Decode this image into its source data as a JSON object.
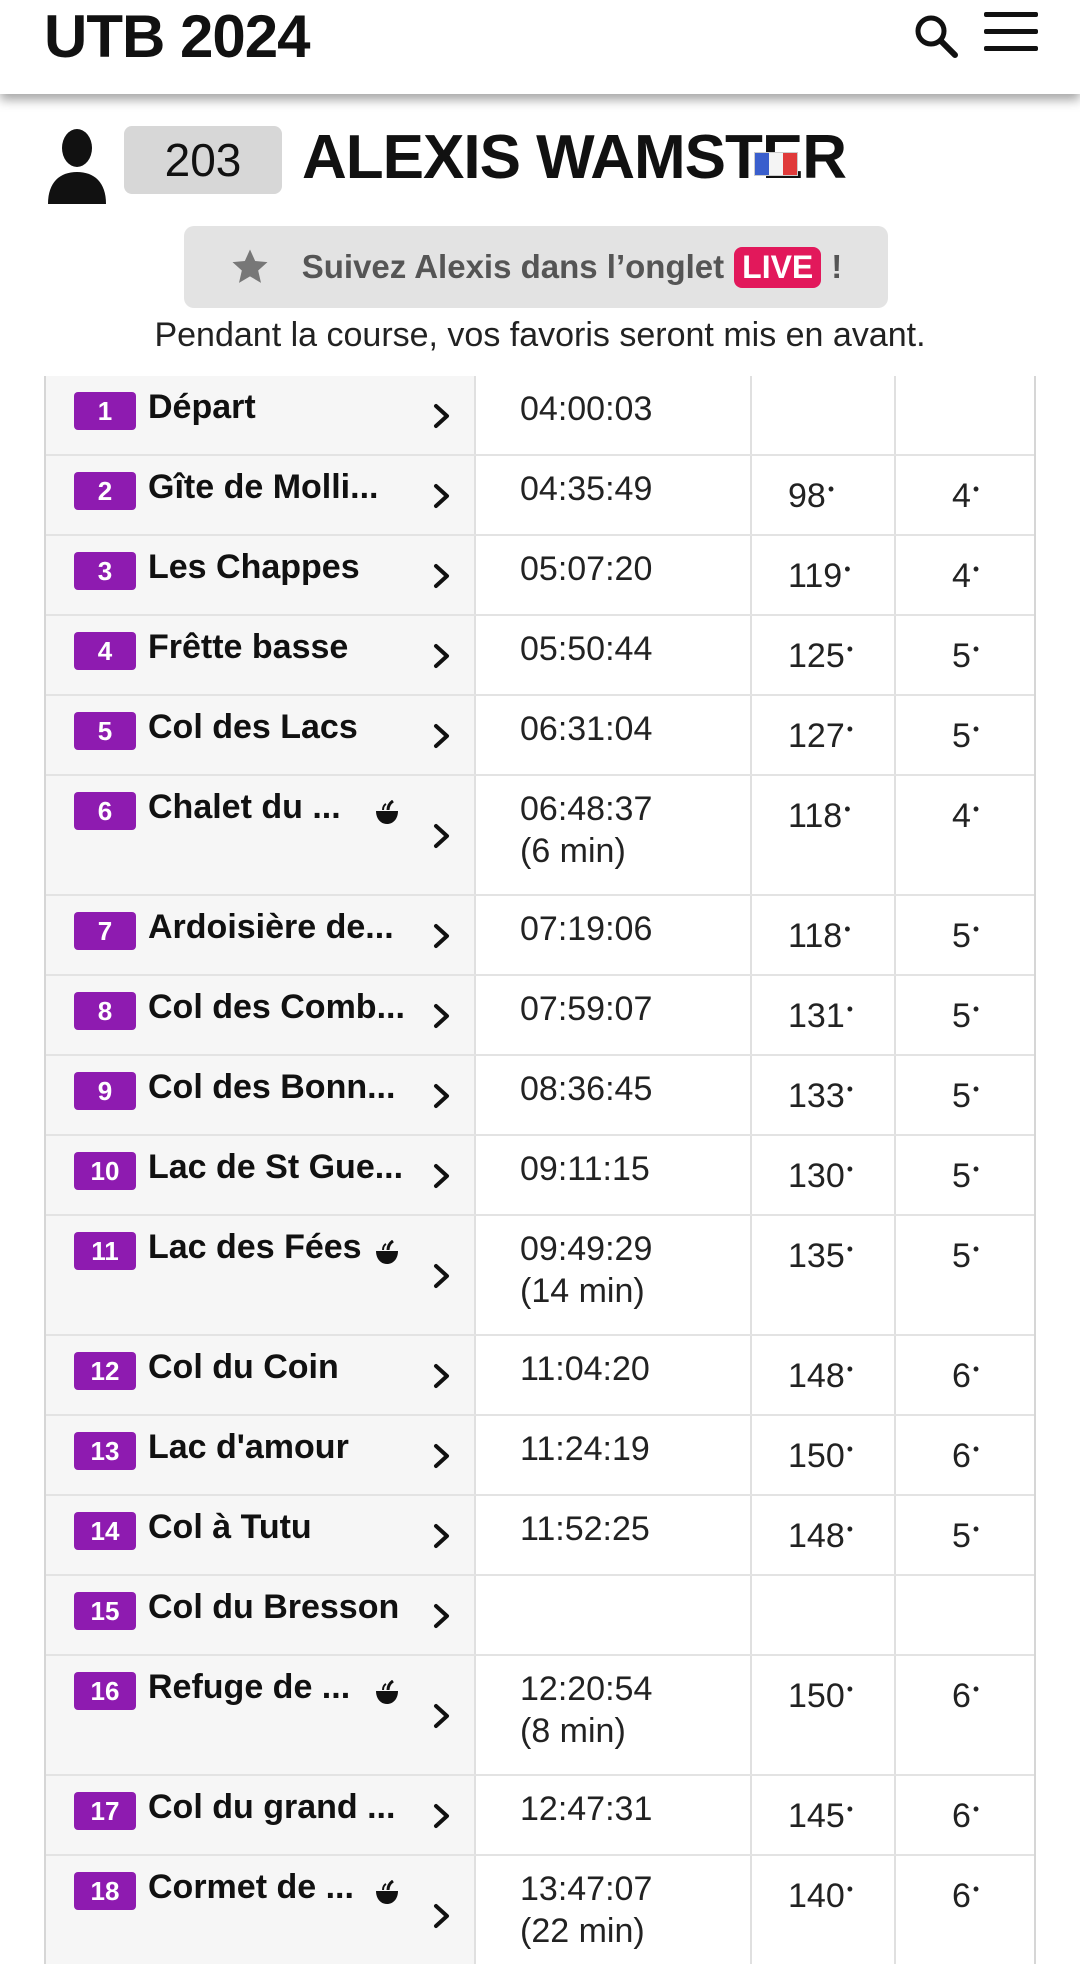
{
  "header": {
    "title": "UTB 2024",
    "search_icon": "search-icon",
    "menu_icon": "hamburger-menu-icon"
  },
  "runner": {
    "bib": "203",
    "name": "ALEXIS WAMSTER",
    "flag": "france-flag-icon"
  },
  "follow": {
    "text": "Suivez Alexis dans l’onglet",
    "live": "LIVE",
    "suffix": "!"
  },
  "note": "Pendant la course, vos favoris seront mis en avant.",
  "colors": {
    "badge": "#8e1bb0",
    "live": "#e2185b"
  },
  "checkpoints": [
    {
      "num": "1",
      "name": "Départ",
      "time": "04:00:03",
      "pause": "",
      "rank": "",
      "crank": "",
      "refreshment": false
    },
    {
      "num": "2",
      "name": "Gîte de Molli...",
      "time": "04:35:49",
      "pause": "",
      "rank": "98",
      "crank": "4",
      "refreshment": false
    },
    {
      "num": "3",
      "name": "Les Chappes",
      "time": "05:07:20",
      "pause": "",
      "rank": "119",
      "crank": "4",
      "refreshment": false
    },
    {
      "num": "4",
      "name": "Frêtte basse",
      "time": "05:50:44",
      "pause": "",
      "rank": "125",
      "crank": "5",
      "refreshment": false
    },
    {
      "num": "5",
      "name": "Col des Lacs",
      "time": "06:31:04",
      "pause": "",
      "rank": "127",
      "crank": "5",
      "refreshment": false
    },
    {
      "num": "6",
      "name": "Chalet du ...",
      "time": "06:48:37",
      "pause": "(6 min)",
      "rank": "118",
      "crank": "4",
      "refreshment": true
    },
    {
      "num": "7",
      "name": "Ardoisière de...",
      "time": "07:19:06",
      "pause": "",
      "rank": "118",
      "crank": "5",
      "refreshment": false
    },
    {
      "num": "8",
      "name": "Col des Comb...",
      "time": "07:59:07",
      "pause": "",
      "rank": "131",
      "crank": "5",
      "refreshment": false
    },
    {
      "num": "9",
      "name": "Col des Bonn...",
      "time": "08:36:45",
      "pause": "",
      "rank": "133",
      "crank": "5",
      "refreshment": false
    },
    {
      "num": "10",
      "name": "Lac de St Gue...",
      "time": "09:11:15",
      "pause": "",
      "rank": "130",
      "crank": "5",
      "refreshment": false
    },
    {
      "num": "11",
      "name": "Lac des Fées",
      "time": "09:49:29",
      "pause": "(14 min)",
      "rank": "135",
      "crank": "5",
      "refreshment": true
    },
    {
      "num": "12",
      "name": "Col du Coin",
      "time": "11:04:20",
      "pause": "",
      "rank": "148",
      "crank": "6",
      "refreshment": false
    },
    {
      "num": "13",
      "name": "Lac d'amour",
      "time": "11:24:19",
      "pause": "",
      "rank": "150",
      "crank": "6",
      "refreshment": false
    },
    {
      "num": "14",
      "name": "Col à Tutu",
      "time": "11:52:25",
      "pause": "",
      "rank": "148",
      "crank": "5",
      "refreshment": false
    },
    {
      "num": "15",
      "name": "Col du Bresson",
      "time": "",
      "pause": "",
      "rank": "",
      "crank": "",
      "refreshment": false
    },
    {
      "num": "16",
      "name": "Refuge de ...",
      "time": "12:20:54",
      "pause": "(8 min)",
      "rank": "150",
      "crank": "6",
      "refreshment": true
    },
    {
      "num": "17",
      "name": "Col du grand ...",
      "time": "12:47:31",
      "pause": "",
      "rank": "145",
      "crank": "6",
      "refreshment": false
    },
    {
      "num": "18",
      "name": "Cormet de ...",
      "time": "13:47:07",
      "pause": "(22 min)",
      "rank": "140",
      "crank": "6",
      "refreshment": true
    }
  ]
}
